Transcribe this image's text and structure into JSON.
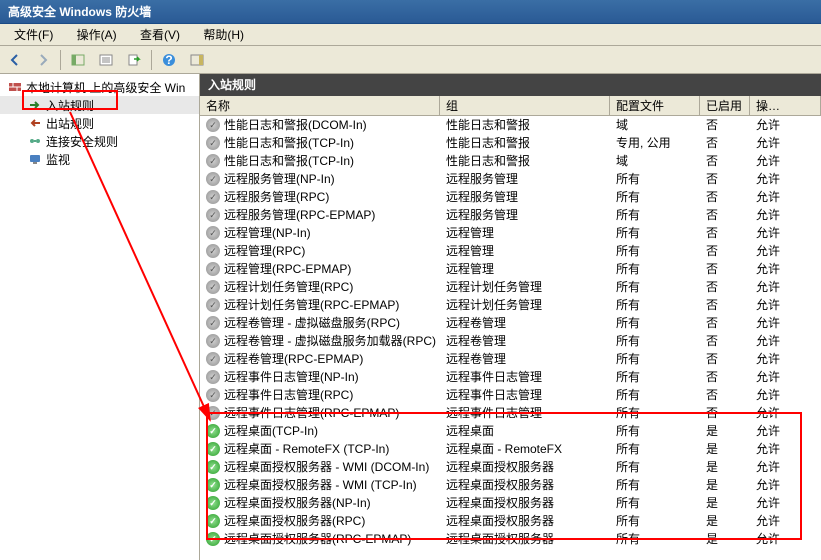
{
  "window": {
    "title": "高级安全 Windows 防火墙"
  },
  "menu": {
    "file": "文件(F)",
    "action": "操作(A)",
    "view": "查看(V)",
    "help": "帮助(H)"
  },
  "tree": {
    "root": "本地计算机 上的高级安全 Win",
    "items": [
      "入站规则",
      "出站规则",
      "连接安全规则",
      "监视"
    ]
  },
  "main": {
    "header": "入站规则",
    "cols": {
      "name": "名称",
      "group": "组",
      "profile": "配置文件",
      "enabled": "已启用",
      "action": "操…"
    }
  },
  "rules": [
    {
      "name": "性能日志和警报(DCOM-In)",
      "group": "性能日志和警报",
      "profile": "域",
      "enabled": "否",
      "action": "允许",
      "on": false
    },
    {
      "name": "性能日志和警报(TCP-In)",
      "group": "性能日志和警报",
      "profile": "专用, 公用",
      "enabled": "否",
      "action": "允许",
      "on": false
    },
    {
      "name": "性能日志和警报(TCP-In)",
      "group": "性能日志和警报",
      "profile": "域",
      "enabled": "否",
      "action": "允许",
      "on": false
    },
    {
      "name": "远程服务管理(NP-In)",
      "group": "远程服务管理",
      "profile": "所有",
      "enabled": "否",
      "action": "允许",
      "on": false
    },
    {
      "name": "远程服务管理(RPC)",
      "group": "远程服务管理",
      "profile": "所有",
      "enabled": "否",
      "action": "允许",
      "on": false
    },
    {
      "name": "远程服务管理(RPC-EPMAP)",
      "group": "远程服务管理",
      "profile": "所有",
      "enabled": "否",
      "action": "允许",
      "on": false
    },
    {
      "name": "远程管理(NP-In)",
      "group": "远程管理",
      "profile": "所有",
      "enabled": "否",
      "action": "允许",
      "on": false
    },
    {
      "name": "远程管理(RPC)",
      "group": "远程管理",
      "profile": "所有",
      "enabled": "否",
      "action": "允许",
      "on": false
    },
    {
      "name": "远程管理(RPC-EPMAP)",
      "group": "远程管理",
      "profile": "所有",
      "enabled": "否",
      "action": "允许",
      "on": false
    },
    {
      "name": "远程计划任务管理(RPC)",
      "group": "远程计划任务管理",
      "profile": "所有",
      "enabled": "否",
      "action": "允许",
      "on": false
    },
    {
      "name": "远程计划任务管理(RPC-EPMAP)",
      "group": "远程计划任务管理",
      "profile": "所有",
      "enabled": "否",
      "action": "允许",
      "on": false
    },
    {
      "name": "远程卷管理 - 虚拟磁盘服务(RPC)",
      "group": "远程卷管理",
      "profile": "所有",
      "enabled": "否",
      "action": "允许",
      "on": false
    },
    {
      "name": "远程卷管理 - 虚拟磁盘服务加载器(RPC)",
      "group": "远程卷管理",
      "profile": "所有",
      "enabled": "否",
      "action": "允许",
      "on": false
    },
    {
      "name": "远程卷管理(RPC-EPMAP)",
      "group": "远程卷管理",
      "profile": "所有",
      "enabled": "否",
      "action": "允许",
      "on": false
    },
    {
      "name": "远程事件日志管理(NP-In)",
      "group": "远程事件日志管理",
      "profile": "所有",
      "enabled": "否",
      "action": "允许",
      "on": false
    },
    {
      "name": "远程事件日志管理(RPC)",
      "group": "远程事件日志管理",
      "profile": "所有",
      "enabled": "否",
      "action": "允许",
      "on": false
    },
    {
      "name": "远程事件日志管理(RPC-EPMAP)",
      "group": "远程事件日志管理",
      "profile": "所有",
      "enabled": "否",
      "action": "允许",
      "on": false
    },
    {
      "name": "远程桌面(TCP-In)",
      "group": "远程桌面",
      "profile": "所有",
      "enabled": "是",
      "action": "允许",
      "on": true
    },
    {
      "name": "远程桌面 - RemoteFX (TCP-In)",
      "group": "远程桌面 - RemoteFX",
      "profile": "所有",
      "enabled": "是",
      "action": "允许",
      "on": true
    },
    {
      "name": "远程桌面授权服务器 - WMI (DCOM-In)",
      "group": "远程桌面授权服务器",
      "profile": "所有",
      "enabled": "是",
      "action": "允许",
      "on": true
    },
    {
      "name": "远程桌面授权服务器 - WMI (TCP-In)",
      "group": "远程桌面授权服务器",
      "profile": "所有",
      "enabled": "是",
      "action": "允许",
      "on": true
    },
    {
      "name": "远程桌面授权服务器(NP-In)",
      "group": "远程桌面授权服务器",
      "profile": "所有",
      "enabled": "是",
      "action": "允许",
      "on": true
    },
    {
      "name": "远程桌面授权服务器(RPC)",
      "group": "远程桌面授权服务器",
      "profile": "所有",
      "enabled": "是",
      "action": "允许",
      "on": true
    },
    {
      "name": "远程桌面授权服务器(RPC-EPMAP)",
      "group": "远程桌面授权服务器",
      "profile": "所有",
      "enabled": "是",
      "action": "允许",
      "on": true
    }
  ]
}
